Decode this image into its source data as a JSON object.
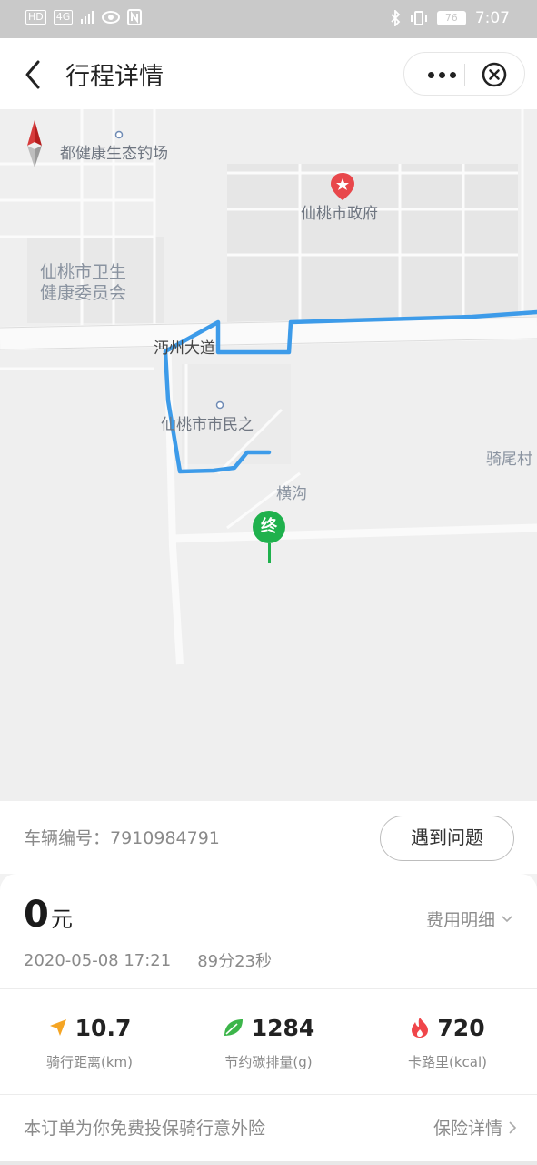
{
  "status_bar": {
    "left_chips": [
      "HD",
      "4G"
    ],
    "time": "7:07",
    "battery": "76",
    "icons": [
      "signal-icon",
      "eye-icon",
      "nfc-icon",
      "bluetooth-icon",
      "vibrate-icon",
      "battery-icon"
    ]
  },
  "header": {
    "title": "行程详情",
    "icons": [
      "back-icon",
      "more-icon",
      "close-icon"
    ]
  },
  "map": {
    "labels": {
      "fishing": "都健康生态钓场",
      "gov": "仙桃市政府",
      "health": "仙桃市卫生\n健康委员会",
      "health_line1": "仙桃市卫生",
      "health_line2": "健康委员会",
      "road": "沔州大道",
      "civil": "仙桃市市民之",
      "qiwei": "骑尾村",
      "henggou": "横沟"
    },
    "end_marker": "终",
    "route_color": "#3d9be9",
    "marker_color": "#1fb14d",
    "poi_color": "#e8474b"
  },
  "vehicle": {
    "label": "车辆编号：7910984791",
    "issue_button": "遇到问题"
  },
  "order": {
    "amount": "0",
    "currency": "元",
    "fee_detail": "费用明细",
    "date": "2020-05-08 17:21",
    "duration": "89分23秒"
  },
  "stats": [
    {
      "value": "10.7",
      "label": "骑行距离(km)",
      "icon": "navigation-arrow-icon",
      "color": "#f5a524"
    },
    {
      "value": "1284",
      "label": "节约碳排量(g)",
      "icon": "leaf-icon",
      "color": "#3cb54a"
    },
    {
      "value": "720",
      "label": "卡路里(kcal)",
      "icon": "flame-icon",
      "color": "#f0454a"
    }
  ],
  "insurance": {
    "text": "本订单为你免费投保骑行意外险",
    "link": "保险详情"
  }
}
